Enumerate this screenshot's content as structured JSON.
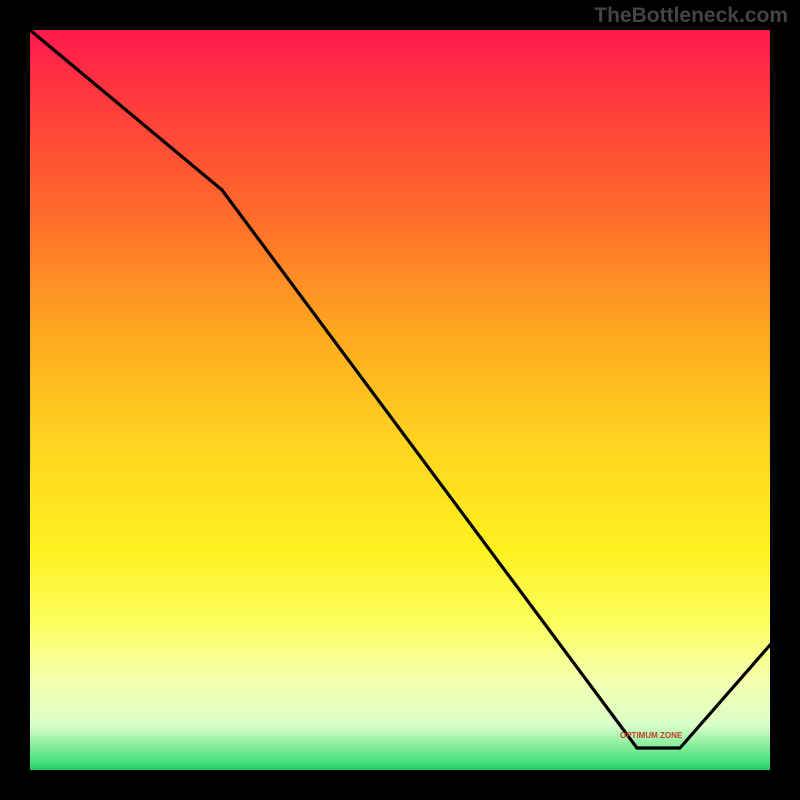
{
  "watermark": "TheBottleneck.com",
  "annotation_label": "OPTIMUM ZONE",
  "chart_data": {
    "type": "line",
    "title": "",
    "xlabel": "",
    "ylabel": "",
    "xlim": [
      0,
      100
    ],
    "ylim": [
      0,
      100
    ],
    "series": [
      {
        "name": "curve",
        "x": [
          0,
          26,
          82,
          88,
          100
        ],
        "values": [
          100,
          78,
          3,
          3,
          17
        ]
      }
    ],
    "annotations": [
      {
        "text": "OPTIMUM ZONE",
        "x": 85,
        "y": 4
      }
    ],
    "gradient_description": "vertical red-to-green heatmap background",
    "notes": "Axes have no visible tick labels; values are normalized 0-100 estimates read from pixel positions."
  }
}
